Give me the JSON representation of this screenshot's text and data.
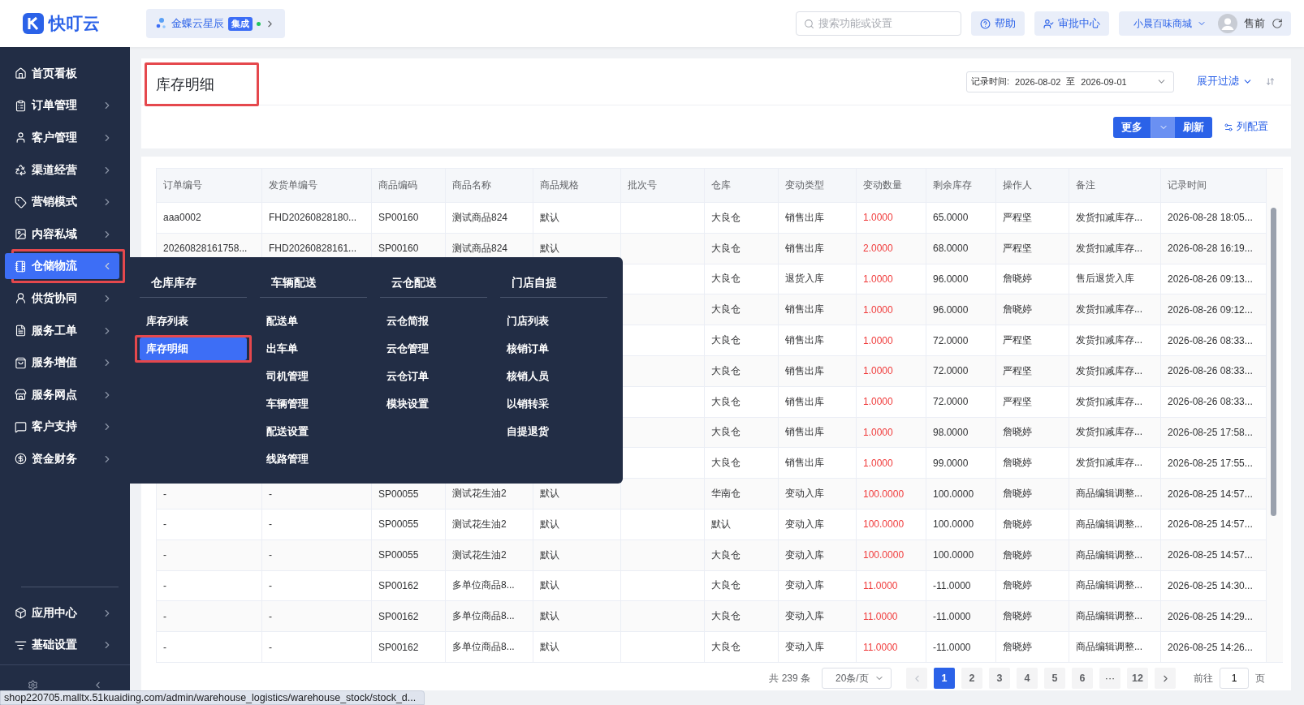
{
  "top_bar": {
    "logo": "快叮云",
    "integration": {
      "name": "金蝶云星辰",
      "badge": "集成",
      "connected": true
    },
    "search": {
      "placeholder": "搜索功能或设置"
    },
    "buttons": [
      {
        "label": "帮助",
        "kind": "help"
      },
      {
        "label": "审批中心",
        "kind": "approval"
      }
    ],
    "store": "小晨百味商城",
    "user": "售前"
  },
  "sidebar": {
    "items": [
      {
        "label": "首页看板",
        "kind": "link",
        "selected": false,
        "highlighted": false
      },
      {
        "label": "订单管理",
        "kind": "group",
        "selected": false,
        "expanded": false,
        "highlighted": false
      },
      {
        "label": "客户管理",
        "kind": "group",
        "selected": false,
        "expanded": false,
        "highlighted": false
      },
      {
        "label": "渠道经营",
        "kind": "group",
        "selected": false,
        "expanded": false,
        "highlighted": false
      },
      {
        "label": "营销模式",
        "kind": "group",
        "selected": false,
        "expanded": false,
        "highlighted": false
      },
      {
        "label": "内容私域",
        "kind": "group",
        "selected": false,
        "expanded": false,
        "highlighted": false
      },
      {
        "label": "仓储物流",
        "kind": "group",
        "selected": true,
        "expanded": true,
        "highlighted": true
      },
      {
        "label": "供货协同",
        "kind": "group",
        "selected": false,
        "expanded": false,
        "highlighted": false
      },
      {
        "label": "服务工单",
        "kind": "group",
        "selected": false,
        "expanded": false,
        "highlighted": false
      },
      {
        "label": "服务增值",
        "kind": "group",
        "selected": false,
        "expanded": false,
        "highlighted": false
      },
      {
        "label": "服务网点",
        "kind": "group",
        "selected": false,
        "expanded": false,
        "highlighted": false
      },
      {
        "label": "客户支持",
        "kind": "group",
        "selected": false,
        "expanded": false,
        "highlighted": false
      },
      {
        "label": "资金财务",
        "kind": "group",
        "selected": false,
        "expanded": false,
        "highlighted": false
      }
    ],
    "bottom_items": [
      {
        "label": "应用中心",
        "kind": "group",
        "selected": false,
        "expanded": false,
        "highlighted": false
      },
      {
        "label": "基础设置",
        "kind": "group",
        "selected": false,
        "expanded": false,
        "highlighted": false
      }
    ]
  },
  "flyout": {
    "columns": [
      {
        "title": "仓库库存",
        "items": [
          {
            "label": "库存列表",
            "selected": false,
            "highlighted": false
          },
          {
            "label": "库存明细",
            "selected": true,
            "highlighted": true
          }
        ]
      },
      {
        "title": "车辆配送",
        "items": [
          {
            "label": "配送单",
            "selected": false,
            "highlighted": false
          },
          {
            "label": "出车单",
            "selected": false,
            "highlighted": false
          },
          {
            "label": "司机管理",
            "selected": false,
            "highlighted": false
          },
          {
            "label": "车辆管理",
            "selected": false,
            "highlighted": false
          },
          {
            "label": "配送设置",
            "selected": false,
            "highlighted": false
          },
          {
            "label": "线路管理",
            "selected": false,
            "highlighted": false
          }
        ]
      },
      {
        "title": "云仓配送",
        "items": [
          {
            "label": "云仓简报",
            "selected": false,
            "highlighted": false
          },
          {
            "label": "云仓管理",
            "selected": false,
            "highlighted": false
          },
          {
            "label": "云仓订单",
            "selected": false,
            "highlighted": false
          },
          {
            "label": "模块设置",
            "selected": false,
            "highlighted": false
          }
        ]
      },
      {
        "title": "门店自提",
        "items": [
          {
            "label": "门店列表",
            "selected": false,
            "highlighted": false
          },
          {
            "label": "核销订单",
            "selected": false,
            "highlighted": false
          },
          {
            "label": "核销人员",
            "selected": false,
            "highlighted": false
          },
          {
            "label": "以销转采",
            "selected": false,
            "highlighted": false
          },
          {
            "label": "自提退货",
            "selected": false,
            "highlighted": false
          }
        ]
      }
    ]
  },
  "page": {
    "title": "库存明细",
    "title_highlighted": true,
    "filter": {
      "label": "记录时间:",
      "start": "2026-08-02",
      "separator": "至",
      "end": "2026-09-01"
    },
    "expand_filter": "展开过滤",
    "actions": {
      "more": "更多",
      "refresh": "刷新",
      "columns": "列配置"
    }
  },
  "table": {
    "columns": [
      {
        "label": "订单编号",
        "kind": "text"
      },
      {
        "label": "发货单编号",
        "kind": "text"
      },
      {
        "label": "商品编码",
        "kind": "text"
      },
      {
        "label": "商品名称",
        "kind": "text"
      },
      {
        "label": "商品规格",
        "kind": "text"
      },
      {
        "label": "批次号",
        "kind": "text"
      },
      {
        "label": "仓库",
        "kind": "text"
      },
      {
        "label": "变动类型",
        "kind": "text"
      },
      {
        "label": "变动数量",
        "kind": "quantity"
      },
      {
        "label": "剩余库存",
        "kind": "text"
      },
      {
        "label": "操作人",
        "kind": "text"
      },
      {
        "label": "备注",
        "kind": "text"
      },
      {
        "label": "记录时间",
        "kind": "text"
      }
    ],
    "rows": [
      {
        "cells": [
          "aaa0002",
          "FHD20260828180...",
          "SP00160",
          "测试商品824",
          "默认",
          null,
          "大良仓",
          "销售出库",
          "1.0000",
          "65.0000",
          "严程坚",
          "发货扣减库存...",
          "2026-08-28 18:05..."
        ]
      },
      {
        "cells": [
          "20260828161758...",
          "FHD20260828161...",
          "SP00160",
          "测试商品824",
          "默认",
          null,
          "大良仓",
          "销售出库",
          "2.0000",
          "68.0000",
          "严程坚",
          "发货扣减库存...",
          "2026-08-28 16:19..."
        ]
      },
      {
        "cells": [
          null,
          null,
          null,
          null,
          null,
          null,
          "大良仓",
          "退货入库",
          "1.0000",
          "96.0000",
          "詹晓婷",
          "售后退货入库",
          "2026-08-26 09:13..."
        ]
      },
      {
        "cells": [
          null,
          null,
          null,
          null,
          null,
          null,
          "大良仓",
          "销售出库",
          "1.0000",
          "96.0000",
          "詹晓婷",
          "发货扣减库存...",
          "2026-08-26 09:12..."
        ]
      },
      {
        "cells": [
          null,
          null,
          null,
          null,
          null,
          null,
          "大良仓",
          "销售出库",
          "1.0000",
          "72.0000",
          "严程坚",
          "发货扣减库存...",
          "2026-08-26 08:33..."
        ]
      },
      {
        "cells": [
          null,
          null,
          null,
          null,
          null,
          null,
          "大良仓",
          "销售出库",
          "1.0000",
          "72.0000",
          "严程坚",
          "发货扣减库存...",
          "2026-08-26 08:33..."
        ]
      },
      {
        "cells": [
          null,
          null,
          null,
          null,
          null,
          null,
          "大良仓",
          "销售出库",
          "1.0000",
          "72.0000",
          "严程坚",
          "发货扣减库存...",
          "2026-08-26 08:33..."
        ]
      },
      {
        "cells": [
          null,
          null,
          null,
          null,
          null,
          null,
          "大良仓",
          "销售出库",
          "1.0000",
          "98.0000",
          "詹晓婷",
          "发货扣减库存...",
          "2026-08-25 17:58..."
        ]
      },
      {
        "cells": [
          null,
          null,
          null,
          null,
          null,
          null,
          "大良仓",
          "销售出库",
          "1.0000",
          "99.0000",
          "詹晓婷",
          "发货扣减库存...",
          "2026-08-25 17:55..."
        ]
      },
      {
        "cells": [
          "-",
          "-",
          "SP00055",
          "测试花生油2",
          "默认",
          null,
          "华南仓",
          "变动入库",
          "100.0000",
          "100.0000",
          "詹晓婷",
          "商品编辑调整...",
          "2026-08-25 14:57..."
        ]
      },
      {
        "cells": [
          "-",
          "-",
          "SP00055",
          "测试花生油2",
          "默认",
          null,
          "默认",
          "变动入库",
          "100.0000",
          "100.0000",
          "詹晓婷",
          "商品编辑调整...",
          "2026-08-25 14:57..."
        ]
      },
      {
        "cells": [
          "-",
          "-",
          "SP00055",
          "测试花生油2",
          "默认",
          null,
          "大良仓",
          "变动入库",
          "100.0000",
          "100.0000",
          "詹晓婷",
          "商品编辑调整...",
          "2026-08-25 14:57..."
        ]
      },
      {
        "cells": [
          "-",
          "-",
          "SP00162",
          "多单位商品8...",
          "默认",
          null,
          "大良仓",
          "变动入库",
          "11.0000",
          "-11.0000",
          "詹晓婷",
          "商品编辑调整...",
          "2026-08-25 14:30..."
        ]
      },
      {
        "cells": [
          "-",
          "-",
          "SP00162",
          "多单位商品8...",
          "默认",
          null,
          "大良仓",
          "变动入库",
          "11.0000",
          "-11.0000",
          "詹晓婷",
          "商品编辑调整...",
          "2026-08-25 14:29..."
        ]
      },
      {
        "cells": [
          "-",
          "-",
          "SP00162",
          "多单位商品8...",
          "默认",
          null,
          "大良仓",
          "变动入库",
          "11.0000",
          "-11.0000",
          "詹晓婷",
          "商品编辑调整...",
          "2026-08-25 14:26..."
        ]
      }
    ]
  },
  "pagination": {
    "total": "共 239 条",
    "page_size": "20条/页",
    "pages": [
      {
        "label": "1",
        "kind": "page",
        "selected": true
      },
      {
        "label": "2",
        "kind": "page",
        "selected": false
      },
      {
        "label": "3",
        "kind": "page",
        "selected": false
      },
      {
        "label": "4",
        "kind": "page",
        "selected": false
      },
      {
        "label": "5",
        "kind": "page",
        "selected": false
      },
      {
        "label": "6",
        "kind": "page",
        "selected": false
      },
      {
        "label": "···",
        "kind": "more",
        "selected": false
      },
      {
        "label": "12",
        "kind": "page",
        "selected": false
      }
    ],
    "goto_label": "前往",
    "goto_value": "1",
    "goto_suffix": "页"
  },
  "status_url": "shop220705.malltx.51kuaiding.com/admin/warehouse_logistics/warehouse_stock/stock_d..."
}
